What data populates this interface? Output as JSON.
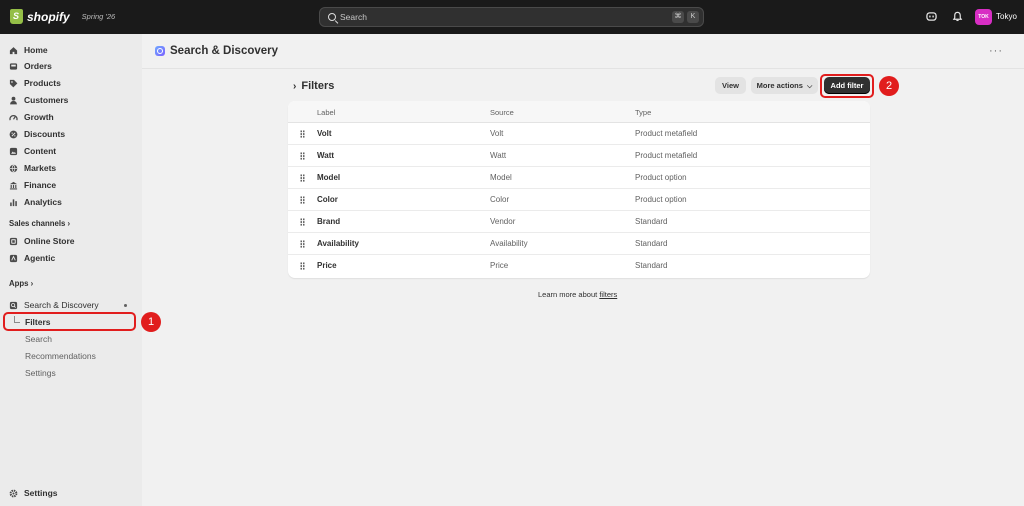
{
  "topbar": {
    "brand": "shopify",
    "edition": "Spring '26",
    "search_placeholder": "Search",
    "shortcut_keys": [
      "⌘",
      "K"
    ],
    "store_avatar": "TOK",
    "store_name": "Tokyo"
  },
  "sidebar": {
    "items": [
      {
        "label": "Home",
        "icon": "home-icon"
      },
      {
        "label": "Orders",
        "icon": "inbox-icon"
      },
      {
        "label": "Products",
        "icon": "tag-icon"
      },
      {
        "label": "Customers",
        "icon": "person-icon"
      },
      {
        "label": "Growth",
        "icon": "gauge-icon"
      },
      {
        "label": "Discounts",
        "icon": "discount-icon"
      },
      {
        "label": "Content",
        "icon": "image-icon"
      },
      {
        "label": "Markets",
        "icon": "globe-icon"
      },
      {
        "label": "Finance",
        "icon": "bank-icon"
      },
      {
        "label": "Analytics",
        "icon": "chart-icon"
      }
    ],
    "sales_channels_label": "Sales channels",
    "sales_channels": [
      {
        "label": "Online Store",
        "icon": "store-icon"
      },
      {
        "label": "Agentic",
        "icon": "agentic-icon"
      }
    ],
    "apps_label": "Apps",
    "app": {
      "label": "Search & Discovery",
      "icon": "search-discovery-icon"
    },
    "app_subitems": [
      "Filters",
      "Search",
      "Recommendations",
      "Settings"
    ],
    "settings_label": "Settings",
    "callout_1": "1"
  },
  "main": {
    "app_title": "Search & Discovery",
    "page_title": "Filters",
    "view_button": "View",
    "more_actions_button": "More actions",
    "add_filter_button": "Add filter",
    "callout_2": "2",
    "table": {
      "headers": [
        "Label",
        "Source",
        "Type"
      ],
      "rows": [
        {
          "label": "Volt",
          "source": "Volt",
          "type": "Product metafield"
        },
        {
          "label": "Watt",
          "source": "Watt",
          "type": "Product metafield"
        },
        {
          "label": "Model",
          "source": "Model",
          "type": "Product option"
        },
        {
          "label": "Color",
          "source": "Color",
          "type": "Product option"
        },
        {
          "label": "Brand",
          "source": "Vendor",
          "type": "Standard"
        },
        {
          "label": "Availability",
          "source": "Availability",
          "type": "Standard"
        },
        {
          "label": "Price",
          "source": "Price",
          "type": "Standard"
        }
      ]
    },
    "learn_more_prefix": "Learn more about",
    "learn_more_link": "filters"
  },
  "colors": {
    "topbar": "#1a1a1a",
    "sidebar": "#ebebeb",
    "background": "#f1f1f1",
    "primary_button": "#303030",
    "callout": "#e11d1d",
    "store_avatar": "#d82ec4"
  }
}
